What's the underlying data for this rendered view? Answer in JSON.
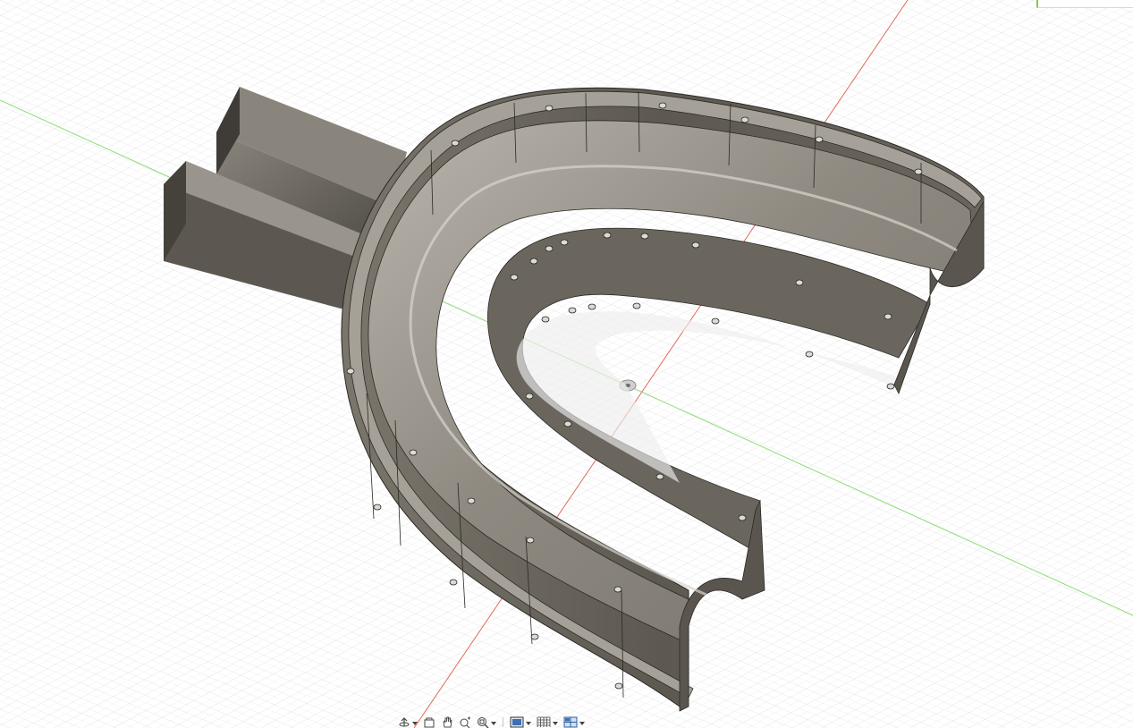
{
  "app": {
    "window_title": "",
    "background_color": "#ffffff",
    "grid_minor_color": "#e6e6e6",
    "grid_major_color": "#cfcfcf",
    "axis_x_color": "#e06a5a",
    "axis_y_color": "#7fd36b",
    "model_color": "#6e6a62",
    "viewcube_accent": "#8cc63f"
  },
  "viewport": {
    "model_name": "mouthguard-tray",
    "origin_marker": "origin-icon"
  },
  "nav_bar": {
    "items": [
      {
        "name": "orbit-icon",
        "has_menu": true
      },
      {
        "name": "look-at-icon",
        "has_menu": false
      },
      {
        "name": "pan-hand-icon",
        "has_menu": false
      },
      {
        "name": "zoom-icon",
        "has_menu": false
      },
      {
        "name": "fit-zoom-icon",
        "has_menu": true
      },
      {
        "name": "display-mode-icon",
        "has_menu": true
      },
      {
        "name": "grid-icon",
        "has_menu": true
      },
      {
        "name": "viewports-icon",
        "has_menu": true
      }
    ]
  }
}
